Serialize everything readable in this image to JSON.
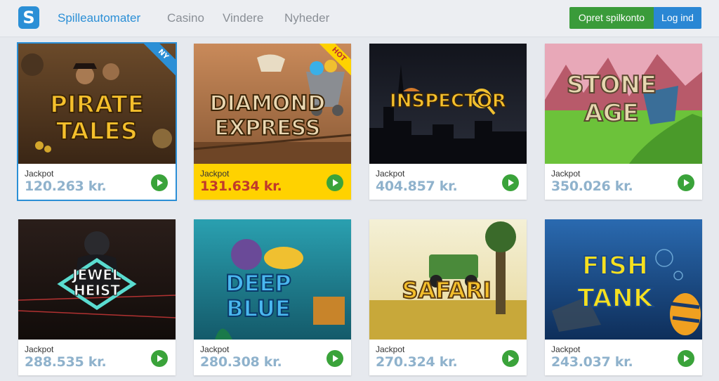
{
  "header": {
    "logo_letter": "S",
    "nav": [
      {
        "label": "Spilleautomater",
        "active": true
      },
      {
        "label": "Casino",
        "active": false
      },
      {
        "label": "Vindere",
        "active": false
      },
      {
        "label": "Nyheder",
        "active": false
      }
    ],
    "signup_label": "Opret spilkonto",
    "login_label": "Log ind"
  },
  "games": [
    {
      "title_lines": [
        "PIRATE",
        "TALES"
      ],
      "badge": "NY",
      "jackpot_label": "Jackpot",
      "jackpot": "120.263 kr.",
      "selected": true
    },
    {
      "title_lines": [
        "DIAMOND",
        "EXPRESS"
      ],
      "badge": "HOT",
      "jackpot_label": "Jackpot",
      "jackpot": "131.634 kr.",
      "hot": true
    },
    {
      "title_lines": [
        "INSPECTOR"
      ],
      "badge": "",
      "jackpot_label": "Jackpot",
      "jackpot": "404.857 kr."
    },
    {
      "title_lines": [
        "STONE",
        "AGE"
      ],
      "badge": "",
      "jackpot_label": "Jackpot",
      "jackpot": "350.026 kr."
    },
    {
      "title_lines": [
        "JEWEL",
        "HEIST"
      ],
      "badge": "",
      "jackpot_label": "Jackpot",
      "jackpot": "288.535 kr."
    },
    {
      "title_lines": [
        "DEEP",
        "BLUE"
      ],
      "badge": "",
      "jackpot_label": "Jackpot",
      "jackpot": "280.308 kr."
    },
    {
      "title_lines": [
        "SAFARI"
      ],
      "badge": "",
      "jackpot_label": "Jackpot",
      "jackpot": "270.324 kr."
    },
    {
      "title_lines": [
        "FISH",
        "TANK"
      ],
      "badge": "",
      "jackpot_label": "Jackpot",
      "jackpot": "243.037 kr."
    }
  ],
  "colors": {
    "accent": "#2b8fd6",
    "signup": "#3a9b3a",
    "hot_footer": "#ffd200",
    "jackpot_text": "#8fb2cc",
    "hot_jackpot_text": "#c0392b"
  }
}
